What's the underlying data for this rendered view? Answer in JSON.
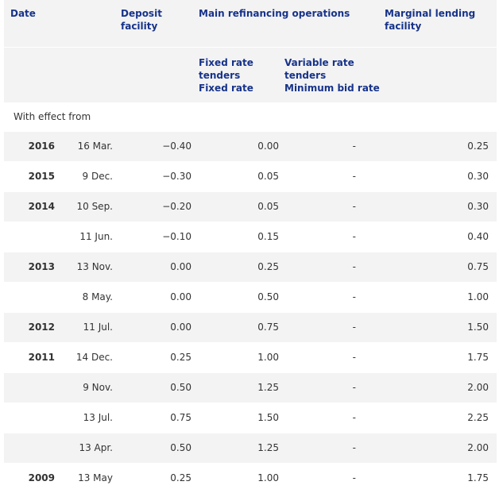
{
  "header": {
    "date": "Date",
    "deposit": "Deposit facility",
    "mro": "Main refinancing operations",
    "marginal_line1": "Marginal lending",
    "marginal_line2": "facility",
    "fixed_line1": "Fixed rate",
    "fixed_line2": "tenders",
    "fixed_line3": "Fixed rate",
    "variable_line1": "Variable rate",
    "variable_line2": "tenders",
    "variable_line3": "Minimum bid rate"
  },
  "section_label": "With effect from",
  "rows": [
    {
      "year": "2016",
      "date": "16 Mar.",
      "deposit": "−0.40",
      "fixed": "0.00",
      "variable": "-",
      "marginal": "0.25"
    },
    {
      "year": "2015",
      "date": "9 Dec.",
      "deposit": "−0.30",
      "fixed": "0.05",
      "variable": "-",
      "marginal": "0.30"
    },
    {
      "year": "2014",
      "date": "10 Sep.",
      "deposit": "−0.20",
      "fixed": "0.05",
      "variable": "-",
      "marginal": "0.30"
    },
    {
      "year": "",
      "date": "11 Jun.",
      "deposit": "−0.10",
      "fixed": "0.15",
      "variable": "-",
      "marginal": "0.40"
    },
    {
      "year": "2013",
      "date": "13 Nov.",
      "deposit": "0.00",
      "fixed": "0.25",
      "variable": "-",
      "marginal": "0.75"
    },
    {
      "year": "",
      "date": "8 May.",
      "deposit": "0.00",
      "fixed": "0.50",
      "variable": "-",
      "marginal": "1.00"
    },
    {
      "year": "2012",
      "date": "11 Jul.",
      "deposit": "0.00",
      "fixed": "0.75",
      "variable": "-",
      "marginal": "1.50"
    },
    {
      "year": "2011",
      "date": "14 Dec.",
      "deposit": "0.25",
      "fixed": "1.00",
      "variable": "-",
      "marginal": "1.75"
    },
    {
      "year": "",
      "date": "9 Nov.",
      "deposit": "0.50",
      "fixed": "1.25",
      "variable": "-",
      "marginal": "2.00"
    },
    {
      "year": "",
      "date": "13 Jul.",
      "deposit": "0.75",
      "fixed": "1.50",
      "variable": "-",
      "marginal": "2.25"
    },
    {
      "year": "",
      "date": "13 Apr.",
      "deposit": "0.50",
      "fixed": "1.25",
      "variable": "-",
      "marginal": "2.00"
    },
    {
      "year": "2009",
      "date": "13 May",
      "deposit": "0.25",
      "fixed": "1.00",
      "variable": "-",
      "marginal": "1.75"
    }
  ]
}
